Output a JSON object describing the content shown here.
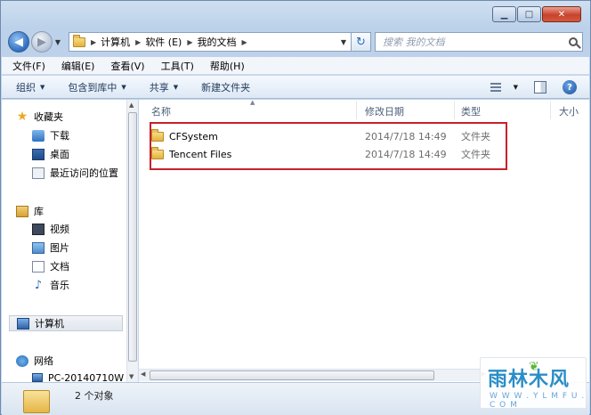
{
  "window": {
    "caption_buttons": {
      "minimize": "▁",
      "maximize": "□",
      "close": "✕"
    }
  },
  "address": {
    "crumbs": [
      "计算机",
      "软件 (E)",
      "我的文档"
    ],
    "search_placeholder": "搜索 我的文档",
    "refresh_symbol": "↻"
  },
  "menu": {
    "items": [
      "文件(F)",
      "编辑(E)",
      "查看(V)",
      "工具(T)",
      "帮助(H)"
    ]
  },
  "toolbar": {
    "organize": "组织",
    "include_in_library": "包含到库中",
    "share": "共享",
    "new_folder": "新建文件夹",
    "help_symbol": "?"
  },
  "navigation": {
    "favorites": {
      "label": "收藏夹",
      "items": [
        "下载",
        "桌面",
        "最近访问的位置"
      ]
    },
    "libraries": {
      "label": "库",
      "items": [
        "视频",
        "图片",
        "文档",
        "音乐"
      ]
    },
    "computer": "计算机",
    "network": {
      "label": "网络",
      "items": [
        "PC-20140710W"
      ]
    }
  },
  "columns": {
    "name": "名称",
    "date": "修改日期",
    "type": "类型",
    "size": "大小"
  },
  "files": [
    {
      "name": "CFSystem",
      "date": "2014/7/18 14:49",
      "type": "文件夹"
    },
    {
      "name": "Tencent Files",
      "date": "2014/7/18 14:49",
      "type": "文件夹"
    }
  ],
  "status": {
    "count_text": "2 个对象"
  },
  "watermark": {
    "title": "雨林木风",
    "url": "W W W . Y L M F U . C O M"
  },
  "colors": {
    "highlight_box": "#c8212b",
    "accent": "#2f6fbf"
  }
}
